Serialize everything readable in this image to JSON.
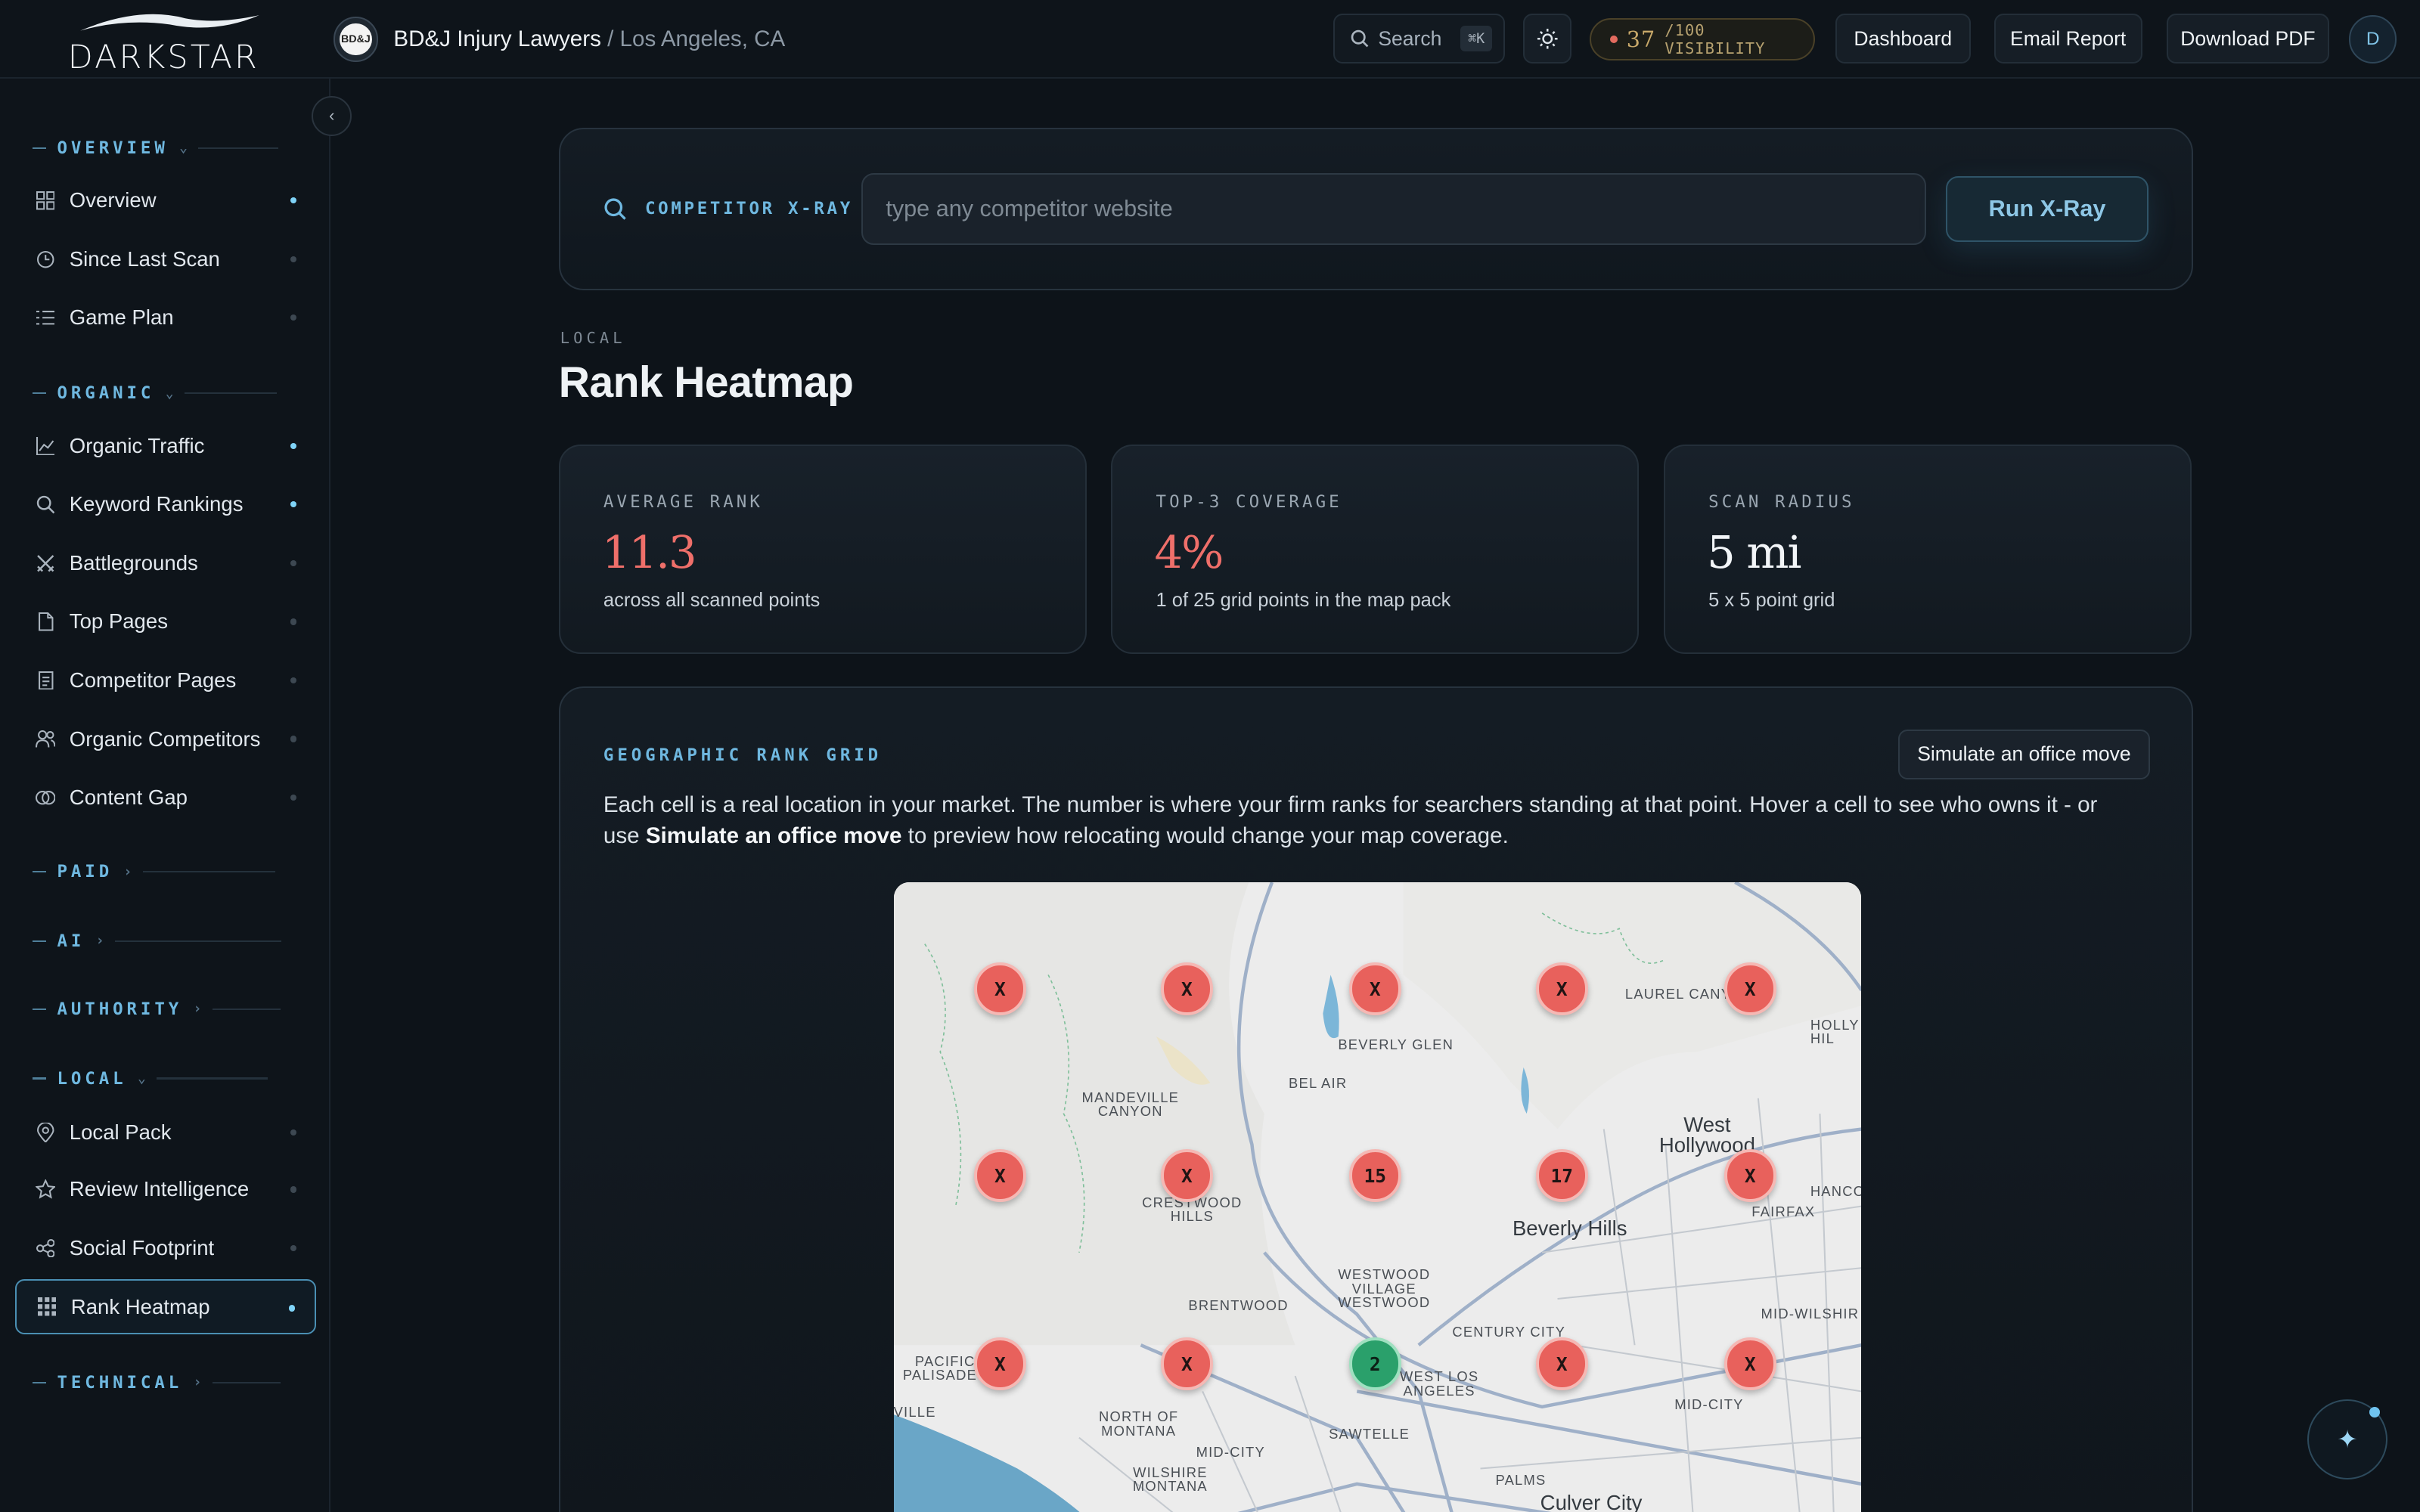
{
  "brand": {
    "name": "DARKSTAR"
  },
  "client": {
    "avatar_text": "BD&J",
    "name": "BD&J Injury Lawyers",
    "location": " / Los Angeles, CA"
  },
  "topbar": {
    "search_label": "Search",
    "search_shortcut": "⌘K",
    "visibility_score": "37",
    "visibility_suffix": "/100 VISIBILITY",
    "dashboard_label": "Dashboard",
    "email_label": "Email Report",
    "pdf_label": "Download PDF",
    "user_initial": "D"
  },
  "sidebar": {
    "sections": {
      "overview": "OVERVIEW",
      "organic": "ORGANIC",
      "paid": "PAID",
      "ai": "AI",
      "authority": "AUTHORITY",
      "local": "LOCAL",
      "technical": "TECHNICAL"
    },
    "items": {
      "overview": "Overview",
      "since_last_scan": "Since Last Scan",
      "game_plan": "Game Plan",
      "organic_traffic": "Organic Traffic",
      "keyword_rankings": "Keyword Rankings",
      "battlegrounds": "Battlegrounds",
      "top_pages": "Top Pages",
      "competitor_pages": "Competitor Pages",
      "organic_competitors": "Organic Competitors",
      "content_gap": "Content Gap",
      "local_pack": "Local Pack",
      "review_intelligence": "Review Intelligence",
      "social_footprint": "Social Footprint",
      "rank_heatmap": "Rank Heatmap"
    }
  },
  "xray": {
    "label": "COMPETITOR X-RAY",
    "placeholder": "type any competitor website",
    "button": "Run X-Ray"
  },
  "page": {
    "eyebrow": "LOCAL",
    "title": "Rank Heatmap"
  },
  "stats": [
    {
      "label": "AVERAGE RANK",
      "value": "11.3",
      "sub": "across all scanned points"
    },
    {
      "label": "TOP-3 COVERAGE",
      "value": "4%",
      "sub": "1 of 25 grid points in the map pack"
    },
    {
      "label": "SCAN RADIUS",
      "value": "5 mi",
      "sub": "5 x 5 point grid"
    }
  ],
  "grid": {
    "title": "GEOGRAPHIC RANK GRID",
    "simulate_button": "Simulate an office move",
    "desc_part1": "Each cell is a real location in your market. The number is where your firm ranks for searchers standing at that point. Hover a cell to see who owns it - or use ",
    "desc_bold": "Simulate an office move",
    "desc_part2": " to preview how relocating would change your map coverage.",
    "pins": {
      "r1": [
        "X",
        "X",
        "X",
        "X",
        "X"
      ],
      "r2": [
        "X",
        "X",
        "15",
        "17",
        "X"
      ],
      "r3": [
        "X",
        "X",
        "2",
        "X",
        "X"
      ]
    },
    "map_labels": {
      "laurel": "LAUREL CANY",
      "holly": "HOLLY\nHIL",
      "beverly_glen": "BEVERLY GLEN",
      "bel_air": "BEL AIR",
      "mandeville": "MANDEVILLE\nCANYON",
      "west_hollywood": "West\nHollywood",
      "crestwood": "CRESTWOOD\nHILLS",
      "hancock": "HANCOCK",
      "fairfax": "FAIRFAX",
      "beverly_hills": "Beverly Hills",
      "westwood": "WESTWOOD\nVILLAGE\nWESTWOOD",
      "brentwood": "BRENTWOOD",
      "century_city": "CENTURY CITY",
      "mid_wilshire": "MID-WILSHIR",
      "pacific": "PACIFIC\nPALISADES",
      "west_la": "WEST LOS\nANGELES",
      "ville": "VILLE",
      "north_montana": "NORTH OF\nMONTANA",
      "mid_city": "MID-CITY",
      "mid_city2": "MID-CITY",
      "sawtelle": "SAWTELLE",
      "wilshire_montana": "WILSHIRE\nMONTANA",
      "palms": "PALMS",
      "culver": "Culver City"
    }
  },
  "colors": {
    "accent": "#6fb8e0",
    "rank_bad": "#e8615c",
    "rank_good": "#2aa06b"
  }
}
